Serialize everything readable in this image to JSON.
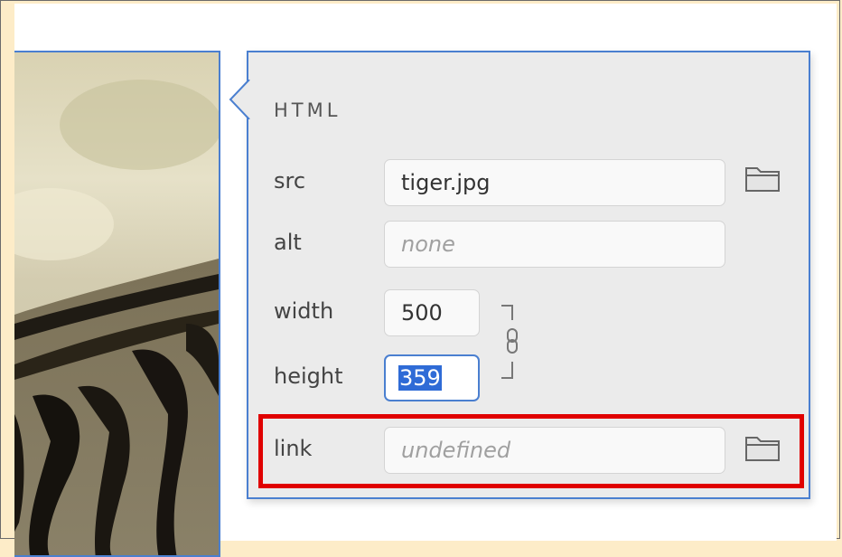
{
  "panel": {
    "title": "HTML",
    "src": {
      "label": "src",
      "value": "tiger.jpg"
    },
    "alt": {
      "label": "alt",
      "placeholder": "none"
    },
    "width": {
      "label": "width",
      "value": "500"
    },
    "height": {
      "label": "height",
      "value": "359"
    },
    "link": {
      "label": "link",
      "placeholder": "undefined"
    }
  },
  "icons": {
    "src_browse": "folder-icon",
    "link_browse": "folder-icon",
    "aspect_lock": "chain-link-icon"
  },
  "colors": {
    "accent": "#4a7fd0",
    "highlight_box": "#e00000",
    "selection": "#2f6bd6",
    "panel_background": "#ebebeb",
    "page_background": "#fdecc8"
  }
}
